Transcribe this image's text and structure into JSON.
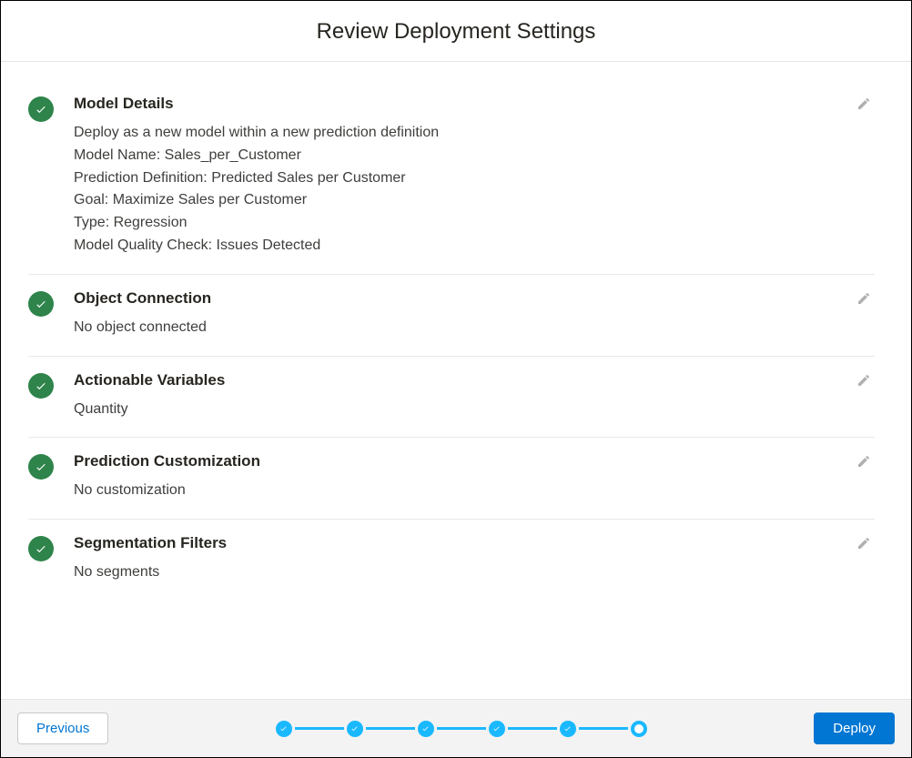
{
  "header": {
    "title": "Review Deployment Settings"
  },
  "sections": {
    "model_details": {
      "title": "Model Details",
      "line0": "Deploy as a new model within a new prediction definition",
      "line1": "Model Name: Sales_per_Customer",
      "line2": "Prediction Definition: Predicted Sales per Customer",
      "line3": "Goal: Maximize Sales per Customer",
      "line4": "Type: Regression",
      "line5": "Model Quality Check: Issues Detected"
    },
    "object_connection": {
      "title": "Object Connection",
      "body": "No object connected"
    },
    "actionable_variables": {
      "title": "Actionable Variables",
      "body": "Quantity"
    },
    "prediction_customization": {
      "title": "Prediction Customization",
      "body": "No customization"
    },
    "segmentation_filters": {
      "title": "Segmentation Filters",
      "body": "No segments"
    }
  },
  "footer": {
    "previous": "Previous",
    "deploy": "Deploy"
  },
  "stepper": {
    "completed": 5,
    "total": 6
  }
}
